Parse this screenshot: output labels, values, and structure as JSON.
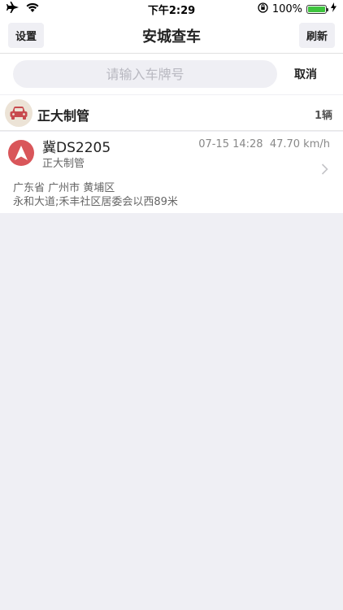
{
  "status_bar": {
    "time": "下午2:29",
    "battery": "100%",
    "battery_level": 1.0,
    "icons": [
      "airplane-icon",
      "wifi-icon",
      "orientation-lock-icon",
      "battery-icon",
      "charging-icon"
    ]
  },
  "nav": {
    "title": "安城查车",
    "left_button": "设置",
    "right_button": "刷新"
  },
  "search": {
    "placeholder": "请输入车牌号",
    "value": "",
    "cancel_label": "取消"
  },
  "group": {
    "name": "正大制管",
    "count": "1辆",
    "icon": "car-icon"
  },
  "vehicles": [
    {
      "plate": "冀DS2205",
      "owner": "正大制管",
      "time": "07-15 14:28",
      "speed": "47.70 km/h",
      "address_line1": "广东省 广州市 黄埔区",
      "address_line2": "永和大道;禾丰社区居委会以西89米",
      "icon": "navigation-arrow-icon"
    }
  ],
  "colors": {
    "background": "#efeff4",
    "accent_red": "#d9565a",
    "battery_green": "#3ec43e"
  }
}
